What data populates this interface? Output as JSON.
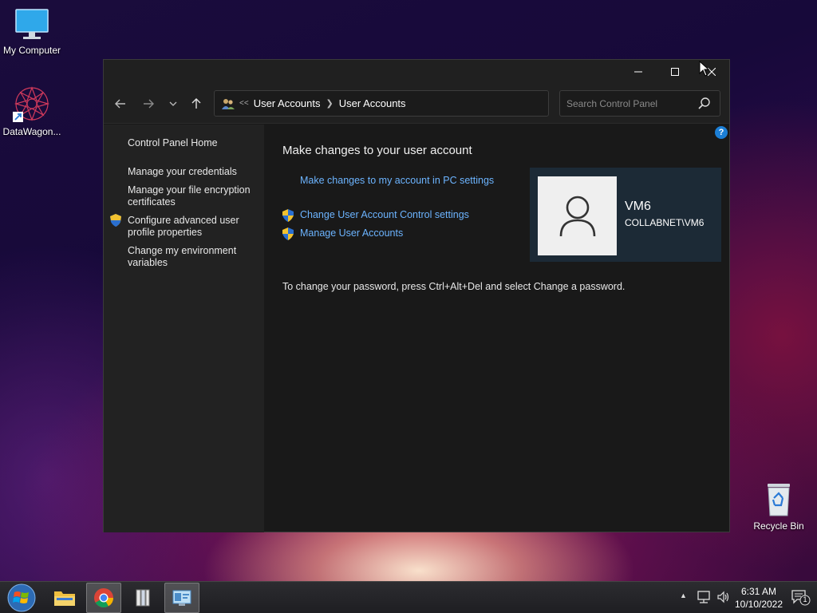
{
  "desktop": {
    "icons": [
      {
        "label": "My Computer"
      },
      {
        "label": "DataWagon..."
      },
      {
        "label": "Recycle Bin"
      }
    ]
  },
  "window": {
    "address": {
      "overflow": "<<",
      "crumbs": [
        "User Accounts",
        "User Accounts"
      ]
    },
    "search": {
      "placeholder": "Search Control Panel"
    },
    "sidebar": {
      "items": [
        {
          "label": "Control Panel Home"
        },
        {
          "label": "Manage your credentials"
        },
        {
          "label": "Manage your file encryption certificates"
        },
        {
          "label": "Configure advanced user profile properties"
        },
        {
          "label": "Change my environment variables"
        }
      ]
    },
    "main": {
      "heading": "Make changes to your user account",
      "links": [
        {
          "label": "Make changes to my account in PC settings"
        },
        {
          "label": "Change User Account Control settings"
        },
        {
          "label": "Manage User Accounts"
        }
      ],
      "note": "To change your password, press Ctrl+Alt+Del and select Change a password.",
      "user": {
        "name": "VM6",
        "domain": "COLLABNET\\VM6"
      }
    },
    "help_glyph": "?"
  },
  "taskbar": {
    "clock": {
      "time": "6:31 AM",
      "date": "10/10/2022"
    },
    "notification_count": "1"
  },
  "colors": {
    "link": "#6cb4ff",
    "help": "#1c7fd6",
    "user_card": "#1c2a36",
    "window_bg": "#191919",
    "sidebar_bg": "#222222"
  }
}
